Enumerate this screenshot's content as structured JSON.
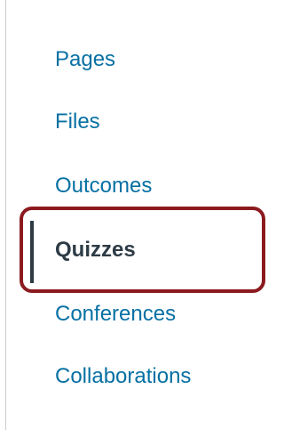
{
  "course_nav": {
    "items": [
      {
        "label": "Pages",
        "active": false
      },
      {
        "label": "Files",
        "active": false
      },
      {
        "label": "Outcomes",
        "active": false
      },
      {
        "label": "Quizzes",
        "active": true
      },
      {
        "label": "Conferences",
        "active": false
      },
      {
        "label": "Collaborations",
        "active": false
      }
    ]
  },
  "colors": {
    "link": "#0770a3",
    "active_text": "#2d3b45",
    "highlight": "#8b1a1f",
    "divider": "#c7cdd1"
  }
}
